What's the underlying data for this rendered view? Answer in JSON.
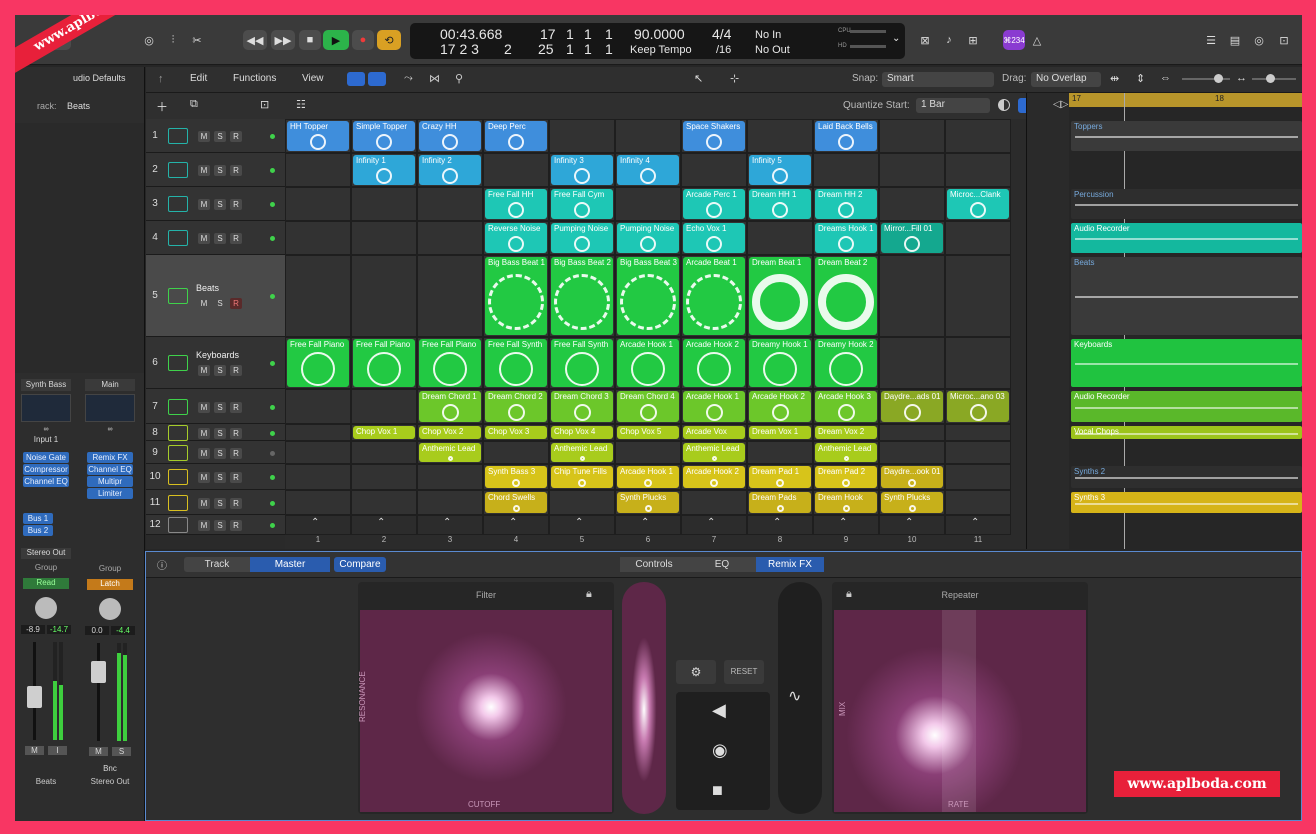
{
  "watermark": "www.aplboda.com",
  "toolbar": {
    "lcd": {
      "time": "00:43.668",
      "bars1": "17",
      "bars2": "1",
      "bars3": "1",
      "bars4": "1",
      "time_sub": "17 2 3",
      "bars_sub": "2",
      "beat_b": "25",
      "beat_b2": "1",
      "beat_b3": "1",
      "beat_b4": "1",
      "tempo": "90.0000",
      "tempo_label": "Keep Tempo",
      "sig": "4/4",
      "sig_sub": "/16",
      "in": "No In",
      "out": "No Out",
      "cpu": "CPU",
      "hd": "HD"
    },
    "badge": "⌘234"
  },
  "menu": {
    "edit": "Edit",
    "functions": "Functions",
    "view": "View",
    "snap_label": "Snap:",
    "snap_value": "Smart",
    "drag_label": "Drag:",
    "drag_value": "No Overlap",
    "quantize_label": "Quantize Start:",
    "quantize_value": "1 Bar"
  },
  "inspector": {
    "defaults": "udio Defaults",
    "track_label": "rack:",
    "track_value": "Beats",
    "strip1": {
      "name": "Synth Bass",
      "input": "Input 1",
      "plugins": [
        "Noise Gate",
        "Compressor",
        "Channel EQ"
      ],
      "sends": [
        "Bus 1",
        "Bus 2"
      ],
      "output": "Stereo Out",
      "group": "Group",
      "auto": "Read",
      "v1": "-8.9",
      "v2": "-14.7",
      "m": "M",
      "i": "I",
      "label": "Beats"
    },
    "strip2": {
      "name": "Main",
      "plugins": [
        "Remix FX",
        "Channel EQ",
        "Multipr",
        "Limiter"
      ],
      "group": "Group",
      "auto": "Latch",
      "v1": "0.0",
      "v2": "-4.4",
      "m": "M",
      "s": "S",
      "bnc": "Bnc",
      "label": "Stereo Out"
    }
  },
  "tracks": [
    {
      "n": "1"
    },
    {
      "n": "2"
    },
    {
      "n": "3"
    },
    {
      "n": "4"
    },
    {
      "n": "5",
      "name": "Beats"
    },
    {
      "n": "6",
      "name": "Keyboards"
    },
    {
      "n": "7"
    },
    {
      "n": "8"
    },
    {
      "n": "9"
    },
    {
      "n": "10"
    },
    {
      "n": "11"
    },
    {
      "n": "12"
    }
  ],
  "msr": {
    "m": "M",
    "s": "S",
    "r": "R"
  },
  "columns": [
    "1",
    "2",
    "3",
    "4",
    "5",
    "6",
    "7",
    "8",
    "9",
    "10",
    "11"
  ],
  "clips": [
    {
      "r": 0,
      "c": 0,
      "t": "HH Topper",
      "k": "b"
    },
    {
      "r": 0,
      "c": 1,
      "t": "Simple Topper",
      "k": "b"
    },
    {
      "r": 0,
      "c": 2,
      "t": "Crazy HH",
      "k": "b"
    },
    {
      "r": 0,
      "c": 3,
      "t": "Deep Perc",
      "k": "b"
    },
    {
      "r": 0,
      "c": 6,
      "t": "Space Shakers",
      "k": "b"
    },
    {
      "r": 0,
      "c": 8,
      "t": "Laid Back Bells",
      "k": "b"
    },
    {
      "r": 1,
      "c": 1,
      "t": "Infinity 1",
      "k": "a"
    },
    {
      "r": 1,
      "c": 2,
      "t": "Infinity 2",
      "k": "a"
    },
    {
      "r": 1,
      "c": 4,
      "t": "Infinity 3",
      "k": "a"
    },
    {
      "r": 1,
      "c": 5,
      "t": "Infinity 4",
      "k": "a"
    },
    {
      "r": 1,
      "c": 7,
      "t": "Infinity 5",
      "k": "a"
    },
    {
      "r": 2,
      "c": 3,
      "t": "Free Fall HH",
      "k": "t"
    },
    {
      "r": 2,
      "c": 4,
      "t": "Free Fall Cym",
      "k": "t"
    },
    {
      "r": 2,
      "c": 6,
      "t": "Arcade Perc 1",
      "k": "t"
    },
    {
      "r": 2,
      "c": 7,
      "t": "Dream HH 1",
      "k": "t"
    },
    {
      "r": 2,
      "c": 8,
      "t": "Dream HH 2",
      "k": "t"
    },
    {
      "r": 2,
      "c": 10,
      "t": "Microc...Clank",
      "k": "t"
    },
    {
      "r": 3,
      "c": 3,
      "t": "Reverse Noise",
      "k": "t"
    },
    {
      "r": 3,
      "c": 4,
      "t": "Pumping Noise",
      "k": "t"
    },
    {
      "r": 3,
      "c": 5,
      "t": "Pumping Noise",
      "k": "t"
    },
    {
      "r": 3,
      "c": 6,
      "t": "Echo Vox 1",
      "k": "t"
    },
    {
      "r": 3,
      "c": 8,
      "t": "Dreams Hook 1",
      "k": "t"
    },
    {
      "r": 3,
      "c": 9,
      "t": "Mirror...Fill 01",
      "k": "t2"
    },
    {
      "r": 4,
      "c": 3,
      "t": "Big Bass Beat 1",
      "k": "g"
    },
    {
      "r": 4,
      "c": 4,
      "t": "Big Bass Beat 2",
      "k": "g"
    },
    {
      "r": 4,
      "c": 5,
      "t": "Big Bass Beat 3",
      "k": "g"
    },
    {
      "r": 4,
      "c": 6,
      "t": "Arcade Beat 1",
      "k": "g"
    },
    {
      "r": 4,
      "c": 7,
      "t": "Dream Beat 1",
      "k": "g"
    },
    {
      "r": 4,
      "c": 8,
      "t": "Dream Beat 2",
      "k": "g"
    },
    {
      "r": 5,
      "c": 0,
      "t": "Free Fall Piano",
      "k": "g"
    },
    {
      "r": 5,
      "c": 1,
      "t": "Free Fall Piano",
      "k": "g"
    },
    {
      "r": 5,
      "c": 2,
      "t": "Free Fall Piano",
      "k": "g"
    },
    {
      "r": 5,
      "c": 3,
      "t": "Free Fall Synth",
      "k": "g"
    },
    {
      "r": 5,
      "c": 4,
      "t": "Free Fall Synth",
      "k": "g"
    },
    {
      "r": 5,
      "c": 5,
      "t": "Arcade Hook 1",
      "k": "g"
    },
    {
      "r": 5,
      "c": 6,
      "t": "Arcade Hook 2",
      "k": "g"
    },
    {
      "r": 5,
      "c": 7,
      "t": "Dreamy Hook 1",
      "k": "g"
    },
    {
      "r": 5,
      "c": 8,
      "t": "Dreamy Hook 2",
      "k": "g"
    },
    {
      "r": 6,
      "c": 2,
      "t": "Dream Chord 1",
      "k": "l"
    },
    {
      "r": 6,
      "c": 3,
      "t": "Dream Chord 2",
      "k": "l"
    },
    {
      "r": 6,
      "c": 4,
      "t": "Dream Chord 3",
      "k": "l"
    },
    {
      "r": 6,
      "c": 5,
      "t": "Dream Chord 4",
      "k": "l"
    },
    {
      "r": 6,
      "c": 6,
      "t": "Arcade Hook 1",
      "k": "l"
    },
    {
      "r": 6,
      "c": 7,
      "t": "Arcade Hook 2",
      "k": "l"
    },
    {
      "r": 6,
      "c": 8,
      "t": "Arcade Hook 3",
      "k": "l"
    },
    {
      "r": 6,
      "c": 9,
      "t": "Daydre...ads 01",
      "k": "o"
    },
    {
      "r": 6,
      "c": 10,
      "t": "Microc...ano 03",
      "k": "o"
    },
    {
      "r": 7,
      "c": 1,
      "t": "Chop Vox 1",
      "k": "y"
    },
    {
      "r": 7,
      "c": 2,
      "t": "Chop Vox 2",
      "k": "y"
    },
    {
      "r": 7,
      "c": 3,
      "t": "Chop Vox 3",
      "k": "y"
    },
    {
      "r": 7,
      "c": 4,
      "t": "Chop Vox 4",
      "k": "y"
    },
    {
      "r": 7,
      "c": 5,
      "t": "Chop Vox 5",
      "k": "y"
    },
    {
      "r": 7,
      "c": 6,
      "t": "Arcade Vox",
      "k": "y"
    },
    {
      "r": 7,
      "c": 7,
      "t": "Dream Vox 1",
      "k": "y"
    },
    {
      "r": 7,
      "c": 8,
      "t": "Dream Vox 2",
      "k": "y"
    },
    {
      "r": 8,
      "c": 2,
      "t": "Anthemic Lead",
      "k": "y"
    },
    {
      "r": 8,
      "c": 4,
      "t": "Anthemic Lead",
      "k": "y"
    },
    {
      "r": 8,
      "c": 6,
      "t": "Anthemic Lead",
      "k": "y"
    },
    {
      "r": 8,
      "c": 8,
      "t": "Anthemic Lead",
      "k": "y"
    },
    {
      "r": 9,
      "c": 3,
      "t": "Synth Bass 3",
      "k": "z"
    },
    {
      "r": 9,
      "c": 4,
      "t": "Chip Tune Fills",
      "k": "z"
    },
    {
      "r": 9,
      "c": 5,
      "t": "Arcade Hook 1",
      "k": "z"
    },
    {
      "r": 9,
      "c": 6,
      "t": "Arcade Hook 2",
      "k": "z"
    },
    {
      "r": 9,
      "c": 7,
      "t": "Dream Pad 1",
      "k": "z"
    },
    {
      "r": 9,
      "c": 8,
      "t": "Dream Pad 2",
      "k": "z"
    },
    {
      "r": 9,
      "c": 9,
      "t": "Daydre...ook 01",
      "k": "z2"
    },
    {
      "r": 10,
      "c": 3,
      "t": "Chord Swells",
      "k": "z2"
    },
    {
      "r": 10,
      "c": 5,
      "t": "Synth Plucks",
      "k": "z2"
    },
    {
      "r": 10,
      "c": 7,
      "t": "Dream Pads",
      "k": "z2"
    },
    {
      "r": 10,
      "c": 8,
      "t": "Dream Hook",
      "k": "z2"
    },
    {
      "r": 10,
      "c": 9,
      "t": "Synth Plucks",
      "k": "z2"
    }
  ],
  "ruler": {
    "m17": "17",
    "m18": "18"
  },
  "regions": [
    {
      "r": 0,
      "t": "Toppers",
      "c": "#3a3a3a"
    },
    {
      "r": 2,
      "t": "Percussion",
      "c": "#2e2e2e"
    },
    {
      "r": 3,
      "t": "Audio Recorder",
      "c": "#14b89e"
    },
    {
      "r": 4,
      "t": "Beats",
      "c": "#3a3a3a"
    },
    {
      "r": 5,
      "t": "Keyboards",
      "c": "#20c340"
    },
    {
      "r": 6,
      "t": "Audio Recorder",
      "c": "#5ab82a"
    },
    {
      "r": 7,
      "t": "Vocal Chops",
      "c": "#9cc41b"
    },
    {
      "r": 9,
      "t": "Synths 2",
      "c": "#2e2e2e"
    },
    {
      "r": 10,
      "t": "Synths 3",
      "c": "#d6b418"
    }
  ],
  "bottom": {
    "track": "Track",
    "master": "Master",
    "compare": "Compare",
    "controls": "Controls",
    "eq": "EQ",
    "remix": "Remix FX",
    "filter": "Filter",
    "repeater": "Repeater",
    "reset": "RESET",
    "resonance": "RESONANCE",
    "cutoff": "CUTOFF",
    "mix": "MIX",
    "rate": "RATE"
  }
}
